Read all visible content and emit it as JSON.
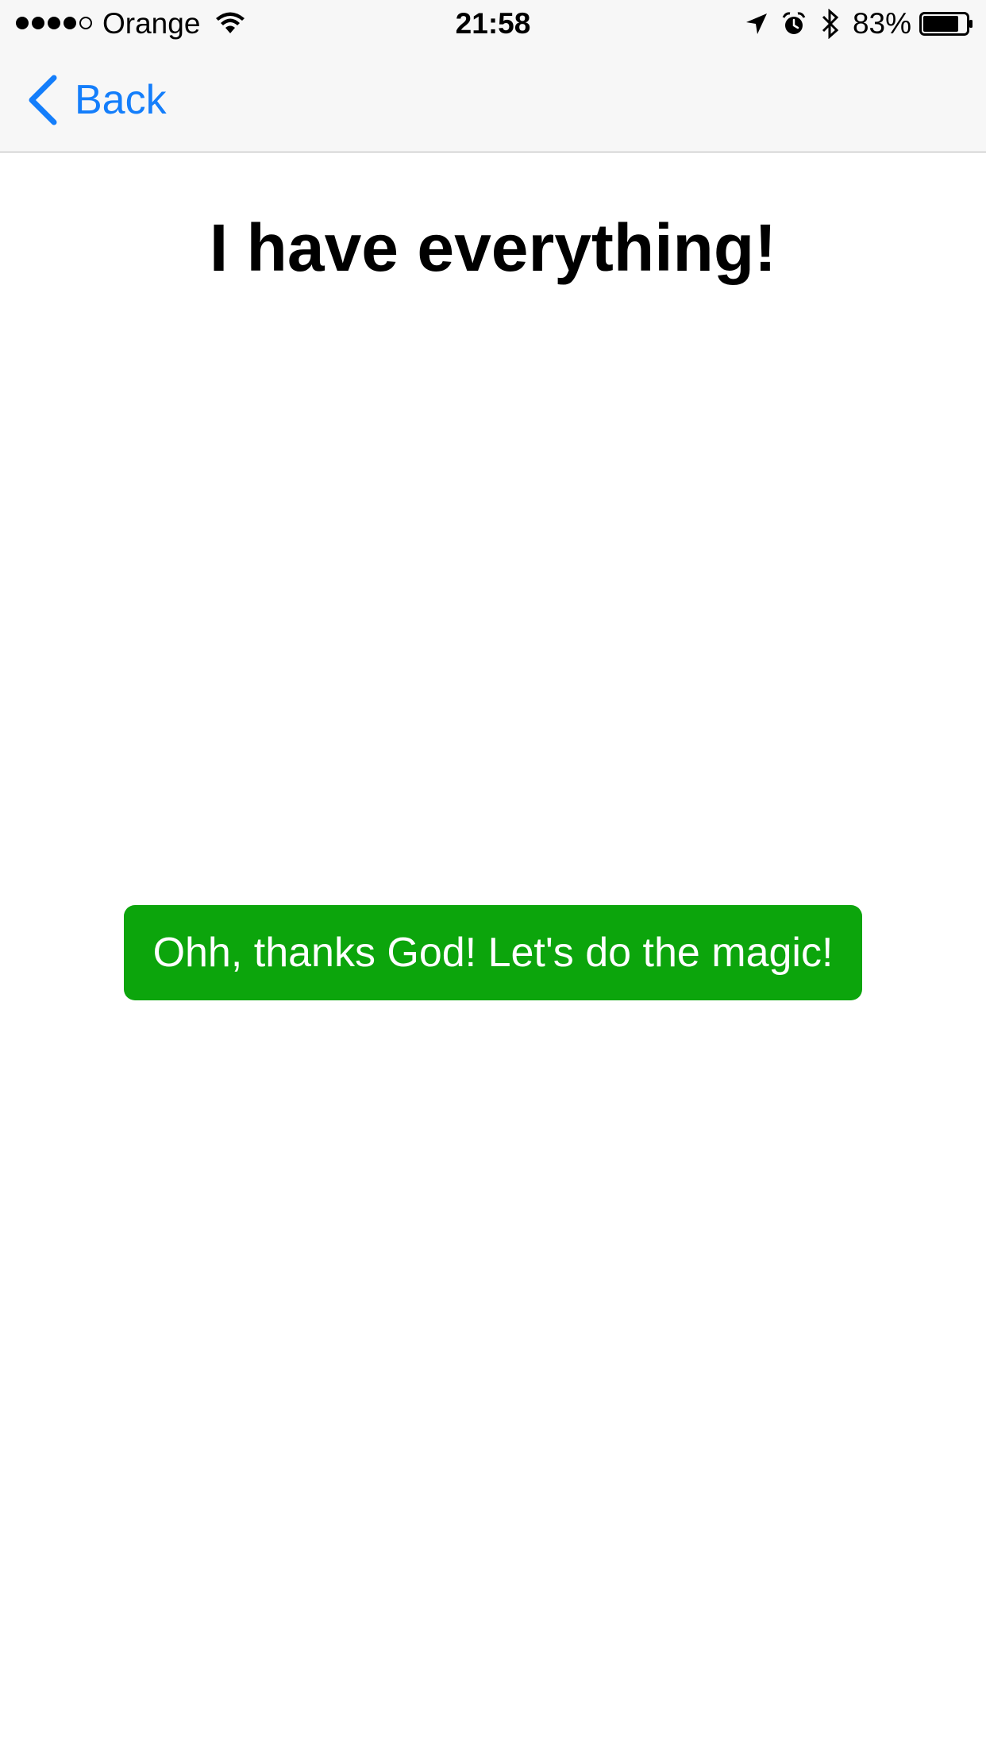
{
  "status_bar": {
    "carrier": "Orange",
    "signal_bars_filled": 4,
    "signal_bars_total": 5,
    "time": "21:58",
    "battery_percent": "83%",
    "battery_level": 0.83,
    "icons": [
      "signal-dots-icon",
      "wifi-icon",
      "location-arrow-icon",
      "alarm-icon",
      "bluetooth-icon",
      "battery-icon"
    ]
  },
  "nav": {
    "back_label": "Back",
    "accent_color": "#147efb"
  },
  "main": {
    "title": "I have everything!",
    "action_label": "Ohh, thanks God! Let's do the magic!",
    "action_color": "#0ca50c"
  }
}
